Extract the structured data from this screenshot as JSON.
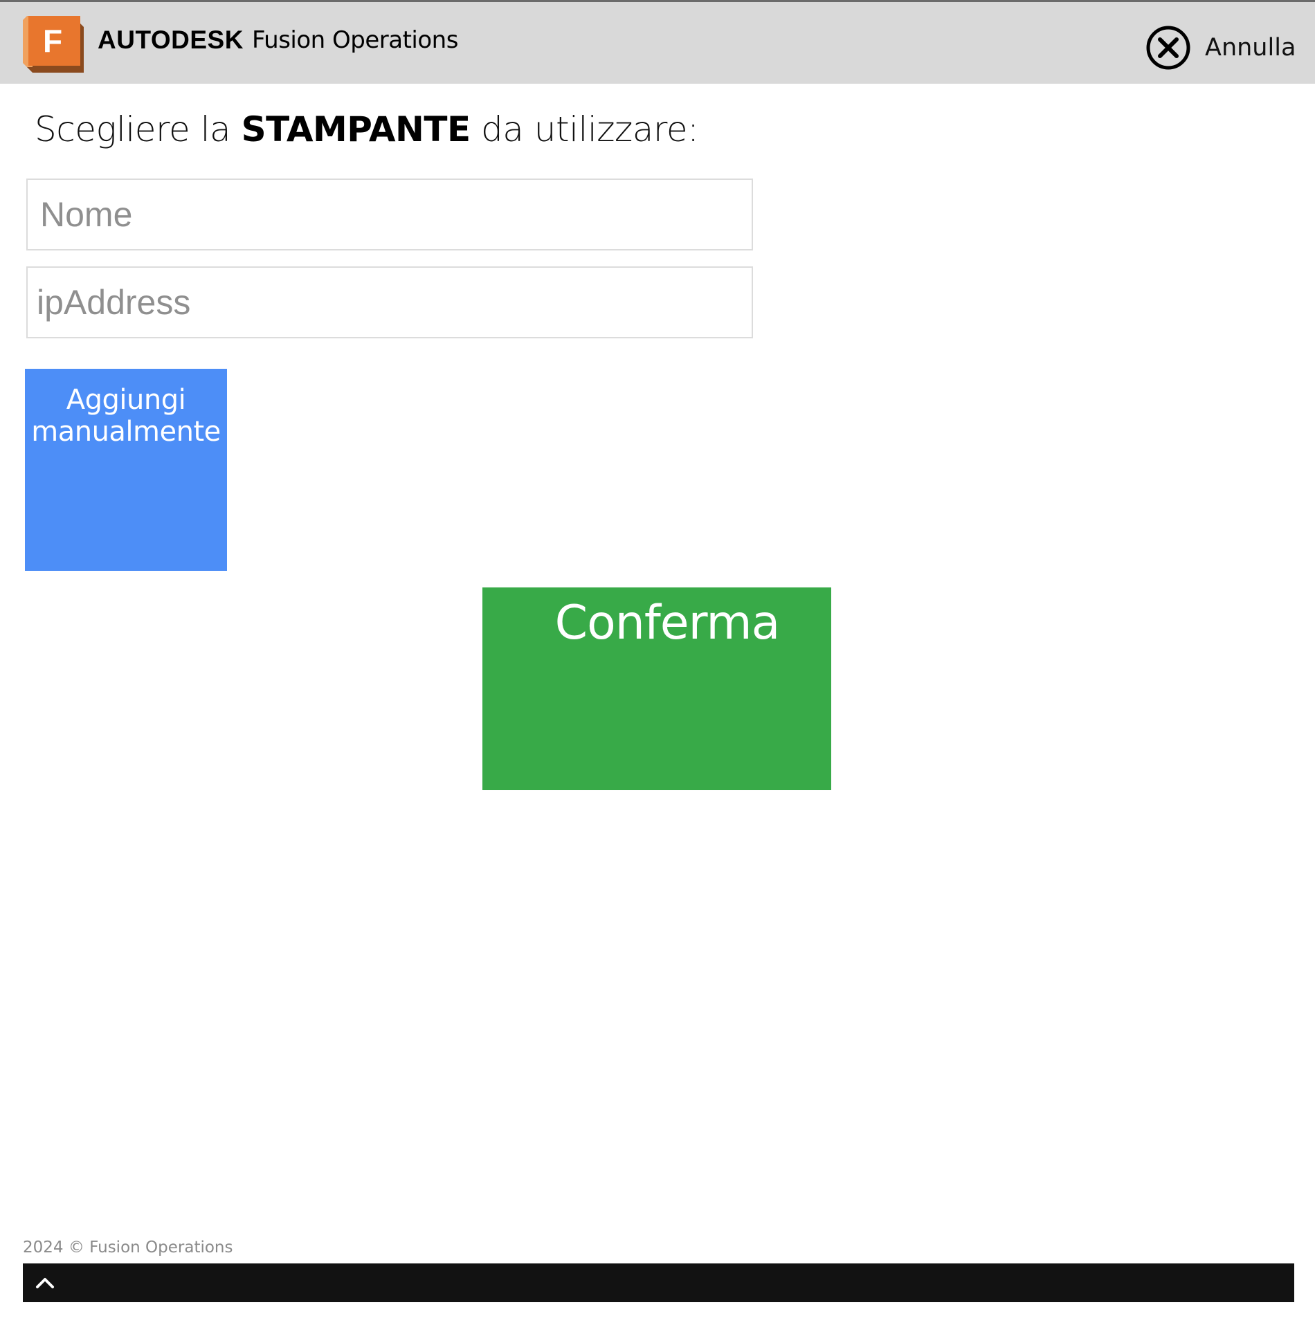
{
  "header": {
    "brand_company": "AUTODESK",
    "brand_product": "Fusion Operations",
    "logo_letter": "F",
    "cancel_label": "Annulla",
    "cancel_icon": "close-circle-icon"
  },
  "main": {
    "heading_prefix": "Scegliere la ",
    "heading_emphasis": "STAMPANTE",
    "heading_suffix": " da utilizzare:",
    "name_input": {
      "placeholder": "Nome",
      "value": ""
    },
    "ip_input": {
      "placeholder": "ipAddress",
      "value": ""
    },
    "add_manual_label": "Aggiungi\nmanualmente",
    "confirm_label": "Conferma"
  },
  "footer": {
    "copyright": "2024 © Fusion Operations",
    "scroll_top_icon": "chevron-up-icon"
  },
  "colors": {
    "header_bg": "#d9d9d9",
    "logo_orange": "#e8762d",
    "add_manual_bg": "#4d8ef7",
    "confirm_bg": "#38aa48",
    "footer_bar_bg": "#121212"
  }
}
